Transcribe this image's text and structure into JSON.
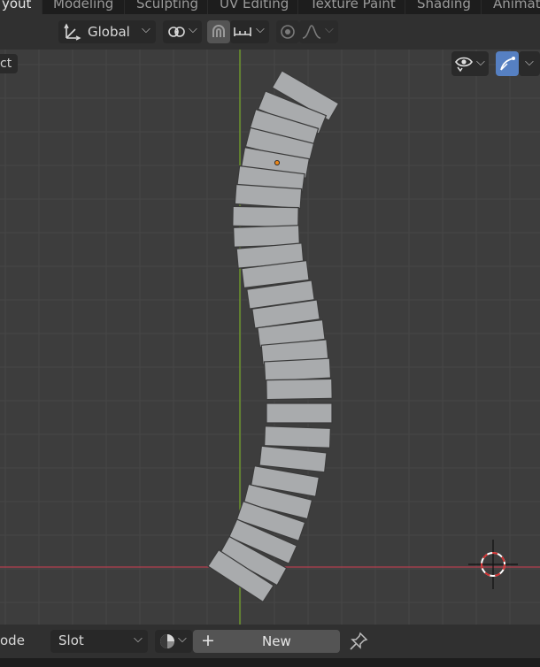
{
  "workspace_tabs": {
    "layout": "yout",
    "modeling": "Modeling",
    "sculpting": "Sculpting",
    "uv_editing": "UV Editing",
    "texture_paint": "Texture Paint",
    "shading": "Shading",
    "animation": "Animati"
  },
  "header": {
    "orientation_label": "Global"
  },
  "viewport": {
    "select_tab_label": "ct"
  },
  "footer": {
    "mode_label": "ode",
    "slot_label": "Slot",
    "new_label": "New",
    "plus_glyph": "+"
  },
  "colors": {
    "x_axis": "#b54050",
    "y_axis": "#6f9a2a",
    "block_fill": "#a9abad",
    "origin_dot": "#e8861c",
    "accent_button": "#5680c2"
  },
  "icons": [
    "transform-orientation-icon",
    "pivot-icon",
    "snap-icon",
    "snap-increment-icon",
    "proportional-edit-icon",
    "falloff-curve-icon",
    "visibility-eye-icon",
    "gizmo-icon",
    "material-sphere-icon",
    "pin-icon",
    "3d-cursor-icon"
  ]
}
